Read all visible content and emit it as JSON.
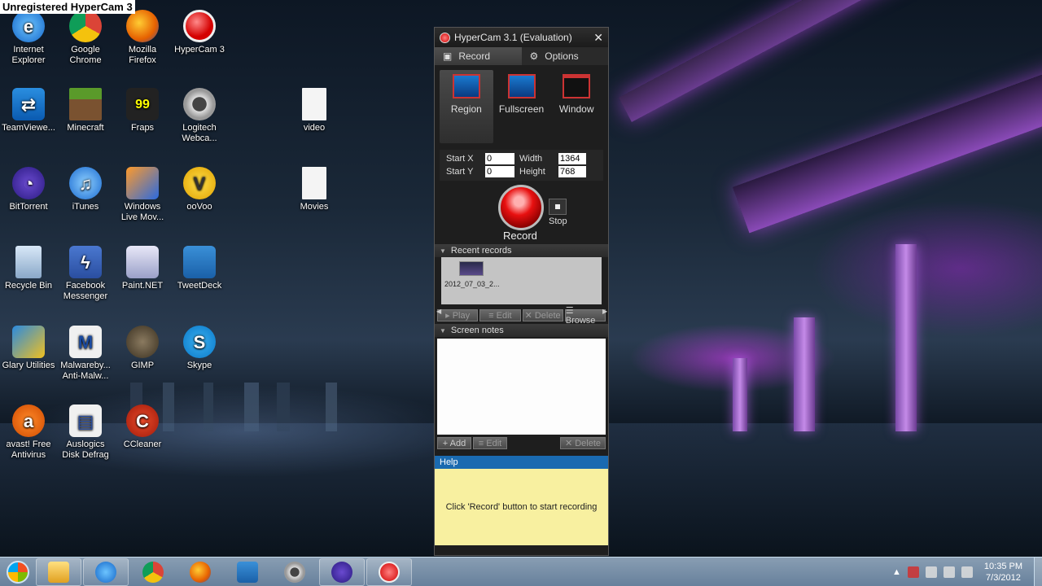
{
  "watermark": "Unregistered HyperCam 3",
  "desktop_icons": [
    {
      "label": "Internet\nExplorer",
      "line1": "Internet",
      "line2": "Explorer"
    },
    {
      "line1": "Google",
      "line2": "Chrome"
    },
    {
      "line1": "Mozilla",
      "line2": "Firefox"
    },
    {
      "line1": "HyperCam 3",
      "line2": ""
    },
    {
      "line1": "TeamViewe...",
      "line2": ""
    },
    {
      "line1": "Minecraft",
      "line2": ""
    },
    {
      "line1": "Fraps",
      "line2": ""
    },
    {
      "line1": "Logitech",
      "line2": "Webca..."
    },
    {
      "line1": "video",
      "line2": ""
    },
    {
      "line1": "BitTorrent",
      "line2": ""
    },
    {
      "line1": "iTunes",
      "line2": ""
    },
    {
      "line1": "Windows",
      "line2": "Live Mov..."
    },
    {
      "line1": "ooVoo",
      "line2": ""
    },
    {
      "line1": "Movies",
      "line2": ""
    },
    {
      "line1": "Recycle Bin",
      "line2": ""
    },
    {
      "line1": "Facebook",
      "line2": "Messenger"
    },
    {
      "line1": "Paint.NET",
      "line2": ""
    },
    {
      "line1": "TweetDeck",
      "line2": ""
    },
    {
      "line1": "Glary Utilities",
      "line2": ""
    },
    {
      "line1": "Malwareby...",
      "line2": "Anti-Malw..."
    },
    {
      "line1": "GIMP",
      "line2": ""
    },
    {
      "line1": "Skype",
      "line2": ""
    },
    {
      "line1": "avast! Free",
      "line2": "Antivirus"
    },
    {
      "line1": "Auslogics",
      "line2": "Disk Defrag"
    },
    {
      "line1": "CCleaner",
      "line2": ""
    }
  ],
  "fraps_badge": "99",
  "oovoo_glyph": "V",
  "hypercam": {
    "title": "HyperCam 3.1 (Evaluation)",
    "close": "✕",
    "tabs": {
      "record": "Record",
      "options": "Options"
    },
    "modes": {
      "region": "Region",
      "fullscreen": "Fullscreen",
      "window": "Window"
    },
    "coords": {
      "start_x_label": "Start X",
      "start_x": "0",
      "start_y_label": "Start Y",
      "start_y": "0",
      "width_label": "Width",
      "width": "1364",
      "height_label": "Height",
      "height": "768"
    },
    "record_label": "Record",
    "stop_label": "Stop",
    "recent_header": "Recent records",
    "recent_item": "2012_07_03_2...",
    "record_actions": {
      "play": "▸ Play",
      "edit": "≡ Edit",
      "delete": "✕ Delete",
      "browse": "☰ Browse"
    },
    "notes_header": "Screen notes",
    "notes_actions": {
      "add": "+ Add",
      "edit": "≡ Edit",
      "delete": "✕ Delete"
    },
    "help_header": "Help",
    "help_text": "Click 'Record' button to start recording"
  },
  "taskbar": {
    "time": "10:35 PM",
    "date": "7/3/2012"
  }
}
